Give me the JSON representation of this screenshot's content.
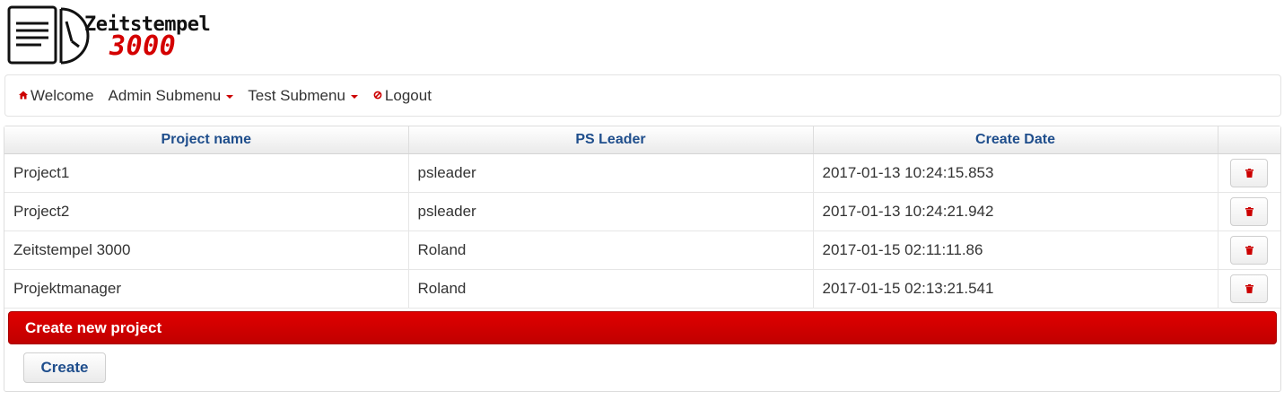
{
  "logo": {
    "line1": "Zeitstempel",
    "line2": "3000"
  },
  "nav": {
    "items": [
      {
        "label": "Welcome",
        "icon": "home-icon"
      },
      {
        "label": "Admin Submenu",
        "icon": "caret-down-icon"
      },
      {
        "label": "Test Submenu",
        "icon": "caret-down-icon"
      },
      {
        "label": "Logout",
        "icon": "logout-icon"
      }
    ]
  },
  "table": {
    "headers": [
      "Project name",
      "PS Leader",
      "Create Date",
      ""
    ],
    "rows": [
      {
        "name": "Project1",
        "leader": "psleader",
        "date": "2017-01-13 10:24:15.853"
      },
      {
        "name": "Project2",
        "leader": "psleader",
        "date": "2017-01-13 10:24:21.942"
      },
      {
        "name": "Zeitstempel 3000",
        "leader": "Roland",
        "date": "2017-01-15 02:11:11.86"
      },
      {
        "name": "Projektmanager",
        "leader": "Roland",
        "date": "2017-01-15 02:13:21.541"
      }
    ]
  },
  "create": {
    "header": "Create new project",
    "button": "Create"
  },
  "colors": {
    "accent": "#cc0000",
    "header_text": "#1f4e8c",
    "text": "#333333"
  }
}
